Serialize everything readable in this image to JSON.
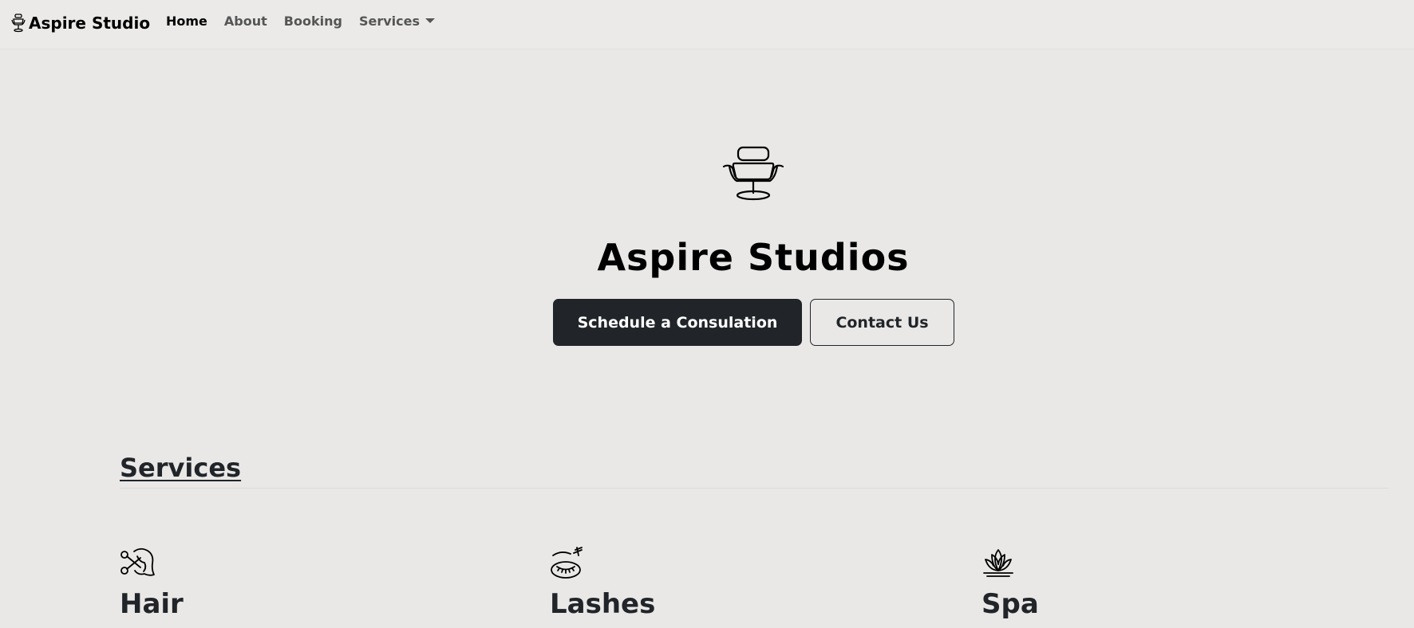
{
  "nav": {
    "brand": "Aspire Studio",
    "brand_icon": "salon-chair-icon",
    "links": [
      {
        "label": "Home",
        "active": true
      },
      {
        "label": "About",
        "active": false
      },
      {
        "label": "Booking",
        "active": false
      },
      {
        "label": "Services",
        "active": false,
        "dropdown": true
      }
    ]
  },
  "hero": {
    "icon": "salon-chair-icon",
    "title": "Aspire Studios",
    "primary_button": "Schedule a Consulation",
    "secondary_button": "Contact Us"
  },
  "services": {
    "heading": "Services",
    "items": [
      {
        "icon": "hair-scissors-icon",
        "title": "Hair"
      },
      {
        "icon": "eyelash-icon",
        "title": "Lashes"
      },
      {
        "icon": "lotus-icon",
        "title": "Spa"
      }
    ]
  },
  "colors": {
    "background": "#e9e8e6",
    "dark_button": "#212529",
    "text": "#212529"
  }
}
